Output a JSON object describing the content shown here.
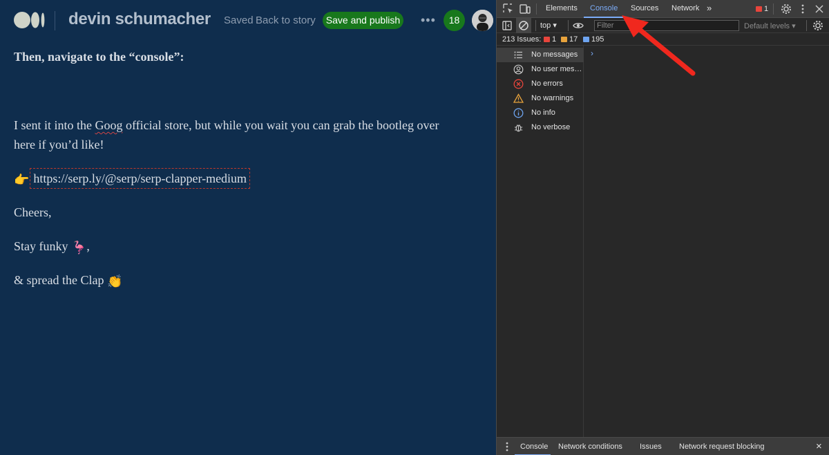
{
  "editor": {
    "author_name": "devin schumacher",
    "saved_status": "Saved",
    "back_link": "Back to story",
    "publish_label": "Save and publish",
    "more_label": "•••",
    "notification_count": "18"
  },
  "story": {
    "p1": "Then, navigate to the “console”:",
    "p2_before": "I sent it into the ",
    "p2_spell": "Goog",
    "p2_after": " official store, but while you wait you can grab the bootleg over",
    "p3": "here if you’d like!",
    "link_emoji": "👉",
    "link_text": "https://serp.ly/@serp/serp-clapper-medium",
    "cheers": "Cheers,",
    "stay_text": "Stay funky ",
    "stay_emoji": "🦩",
    "stay_comma": ",",
    "spread_text": "& spread the Clap ",
    "spread_emoji": "👏"
  },
  "devtools": {
    "tabs": [
      "Elements",
      "Console",
      "Sources",
      "Network"
    ],
    "more_tabs": "»",
    "error_count": "1",
    "toolbar": {
      "context": "top ▾",
      "filter_placeholder": "Filter",
      "levels": "Default levels ▾"
    },
    "issues": {
      "label": "213 Issues:",
      "errors": "1",
      "warnings": "17",
      "info": "195"
    },
    "sidebar": [
      {
        "label": "No messages",
        "icon": "list-icon"
      },
      {
        "label": "No user messages",
        "icon": "user-icon"
      },
      {
        "label": "No errors",
        "icon": "error-icon"
      },
      {
        "label": "No warnings",
        "icon": "warning-icon"
      },
      {
        "label": "No info",
        "icon": "info-icon"
      },
      {
        "label": "No verbose",
        "icon": "bug-icon"
      }
    ],
    "prompt": "›",
    "drawer_tabs": [
      "Console",
      "Network conditions",
      "Issues",
      "Network request blocking"
    ],
    "close": "×"
  },
  "colors": {
    "editor_bg": "#0f2d4d",
    "publish_green": "#18781c",
    "devtools_bg": "#282828",
    "accent_blue": "#7cacf8",
    "arrow_red": "#f0281e"
  }
}
